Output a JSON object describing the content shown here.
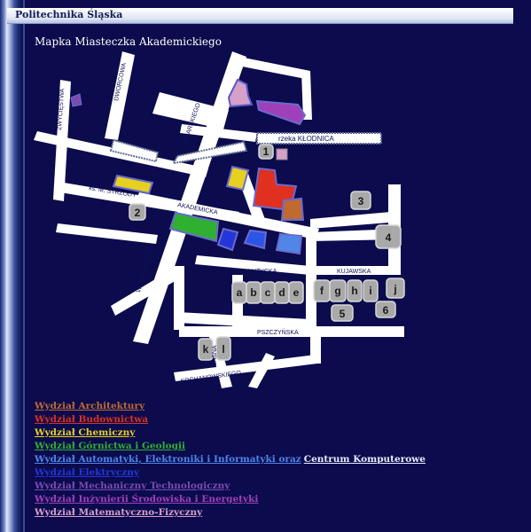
{
  "header": {
    "title": "Politechnika Śląska"
  },
  "map": {
    "title": "Mapka Miasteczka Akademickiego",
    "street_labels": {
      "zwyciestwa": "ZWYCIĘSTWA",
      "dworcowa": "DWORCOWA",
      "konarskiego": "KONARSKIEGO",
      "klodnica": "rzeka KŁODNICA",
      "strzody": "ks. M. STRZODY",
      "akademicka": "AKADEMICKA",
      "wroclawska": "WROCŁAWSKA",
      "luzycka": "ŁUŻYCKA",
      "kujawska": "KUJAWSKA",
      "pszczynska": "PSZCZYŃSKA",
      "jasna": "JASNA",
      "kochanowskiego": "KOCHANOWSKIEGO"
    },
    "building_labels": {
      "b1": "1",
      "b2": "2",
      "b3": "3",
      "b4": "4",
      "b5": "5",
      "b6": "6",
      "a": "a",
      "b": "b",
      "c": "c",
      "d": "d",
      "e": "e",
      "f": "f",
      "g": "g",
      "h": "h",
      "i": "i",
      "j": "j",
      "k": "k",
      "l": "l"
    }
  },
  "legend": [
    {
      "label": "Wydział Architektury",
      "color": "#c06a30"
    },
    {
      "label": "Wydział Budownictwa",
      "color": "#e03020"
    },
    {
      "label": "Wydział Chemiczny",
      "color": "#e6d020"
    },
    {
      "label": "Wydział Górnictwa i Geologii",
      "color": "#30b030"
    },
    {
      "label": "Wydział Automatyki, Elektroniki i Informatyki oraz",
      "color": "#4f86e8"
    },
    {
      "label": "Wydział Elektryczny",
      "color": "#2436d8"
    },
    {
      "label": "Wydział Mechaniczny Technologiczny",
      "color": "#7a4cb0"
    },
    {
      "label": "Wydział Inżynierii Środowiska i Energetyki",
      "color": "#a040b8"
    },
    {
      "label": "Wydział Matematyczno-Fizyczny",
      "color": "#d7a0c8"
    }
  ],
  "legend_extra": "Centrum Komputerowe"
}
